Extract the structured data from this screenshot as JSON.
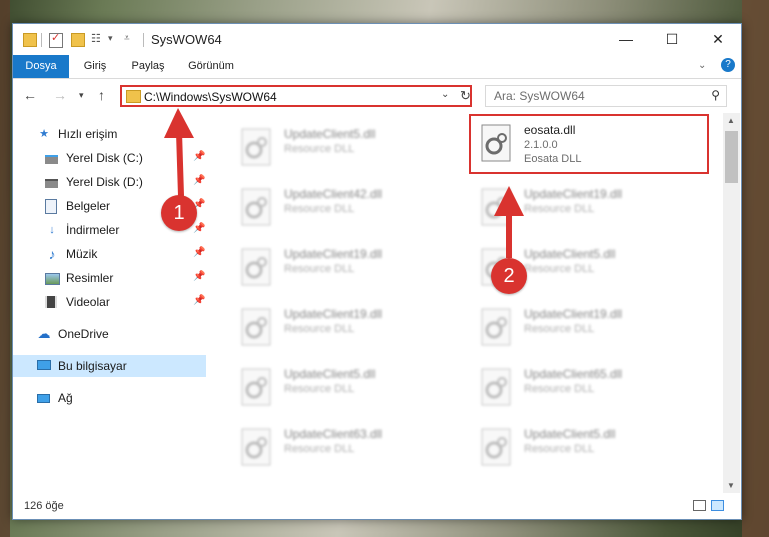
{
  "window": {
    "title": "SysWOW64",
    "controls": {
      "minimize": "—",
      "maximize": "☐",
      "close": "✕"
    }
  },
  "ribbon": {
    "tabs": [
      "Dosya",
      "Giriş",
      "Paylaş",
      "Görünüm"
    ],
    "help_icon": "?"
  },
  "address": {
    "path": "C:\\Windows\\SysWOW64",
    "search_placeholder": "Ara: SysWOW64"
  },
  "sidebar": {
    "items": [
      {
        "label": "Hızlı erişim",
        "icon": "star-icon"
      },
      {
        "label": "Yerel Disk (C:)",
        "icon": "drive-icon",
        "pinned": true
      },
      {
        "label": "Yerel Disk (D:)",
        "icon": "drive-icon",
        "pinned": true
      },
      {
        "label": "Belgeler",
        "icon": "document-icon",
        "pinned": true
      },
      {
        "label": "İndirmeler",
        "icon": "download-icon",
        "pinned": true
      },
      {
        "label": "Müzik",
        "icon": "music-icon",
        "pinned": true
      },
      {
        "label": "Resimler",
        "icon": "pictures-icon",
        "pinned": true
      },
      {
        "label": "Videolar",
        "icon": "video-icon",
        "pinned": true
      },
      {
        "label": "OneDrive",
        "icon": "cloud-icon"
      },
      {
        "label": "Bu bilgisayar",
        "icon": "computer-icon",
        "selected": true
      },
      {
        "label": "Ağ",
        "icon": "network-icon"
      }
    ]
  },
  "files": {
    "highlighted": {
      "name": "eosata.dll",
      "version": "2.1.0.0",
      "description": "Eosata DLL"
    },
    "left_column": [
      {
        "name": "UpdateClient5.dll",
        "description": "Resource DLL"
      },
      {
        "name": "UpdateClient42.dll",
        "description": "Resource DLL"
      },
      {
        "name": "UpdateClient19.dll",
        "description": "Resource DLL"
      },
      {
        "name": "UpdateClient19.dll",
        "description": "Resource DLL"
      },
      {
        "name": "UpdateClient5.dll",
        "description": "Resource DLL"
      },
      {
        "name": "UpdateClient63.dll",
        "description": "Resource DLL"
      }
    ],
    "right_column": [
      {
        "name": "UpdateClient19.dll",
        "description": "Resource DLL"
      },
      {
        "name": "UpdateClient5.dll",
        "description": "Resource DLL"
      },
      {
        "name": "UpdateClient19.dll",
        "description": "Resource DLL"
      },
      {
        "name": "UpdateClient65.dll",
        "description": "Resource DLL"
      },
      {
        "name": "UpdateClient5.dll",
        "description": "Resource DLL"
      }
    ]
  },
  "status": {
    "item_count": "126 öğe"
  },
  "callouts": {
    "one": "1",
    "two": "2"
  },
  "colors": {
    "accent": "#1979ca",
    "highlight": "#d9332f",
    "selection": "#cce8ff"
  }
}
